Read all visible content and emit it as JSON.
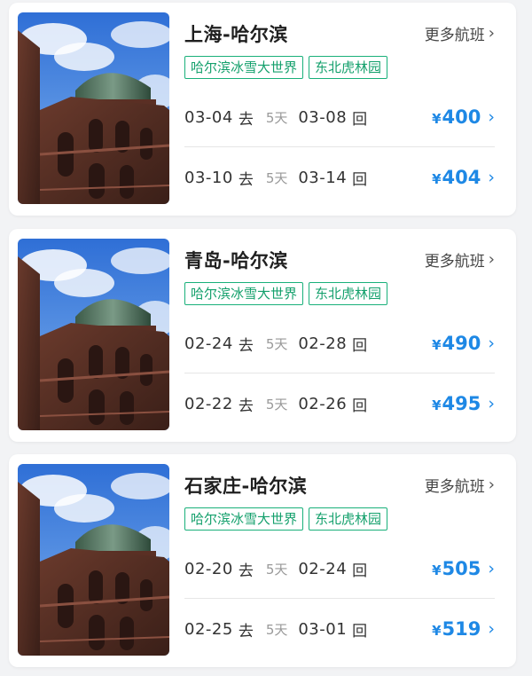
{
  "cards": [
    {
      "route": "上海-哈尔滨",
      "more": "更多航班",
      "tags": [
        "哈尔滨冰雪大世界",
        "东北虎林园"
      ],
      "flights": [
        {
          "depart": "03-04",
          "go": "去",
          "days": "5天",
          "ret": "03-08",
          "back": "回",
          "currency": "¥",
          "price": "400"
        },
        {
          "depart": "03-10",
          "go": "去",
          "days": "5天",
          "ret": "03-14",
          "back": "回",
          "currency": "¥",
          "price": "404"
        }
      ]
    },
    {
      "route": "青岛-哈尔滨",
      "more": "更多航班",
      "tags": [
        "哈尔滨冰雪大世界",
        "东北虎林园"
      ],
      "flights": [
        {
          "depart": "02-24",
          "go": "去",
          "days": "5天",
          "ret": "02-28",
          "back": "回",
          "currency": "¥",
          "price": "490"
        },
        {
          "depart": "02-22",
          "go": "去",
          "days": "5天",
          "ret": "02-26",
          "back": "回",
          "currency": "¥",
          "price": "495"
        }
      ]
    },
    {
      "route": "石家庄-哈尔滨",
      "more": "更多航班",
      "tags": [
        "哈尔滨冰雪大世界",
        "东北虎林园"
      ],
      "flights": [
        {
          "depart": "02-20",
          "go": "去",
          "days": "5天",
          "ret": "02-24",
          "back": "回",
          "currency": "¥",
          "price": "505"
        },
        {
          "depart": "02-25",
          "go": "去",
          "days": "5天",
          "ret": "03-01",
          "back": "回",
          "currency": "¥",
          "price": "519"
        }
      ]
    }
  ],
  "icons": {
    "more": "chevron-right-icon",
    "price": "chevron-right-icon"
  },
  "colors": {
    "accent": "#1e88e5",
    "tag": "#14a06c",
    "background": "#f2f3f5"
  }
}
